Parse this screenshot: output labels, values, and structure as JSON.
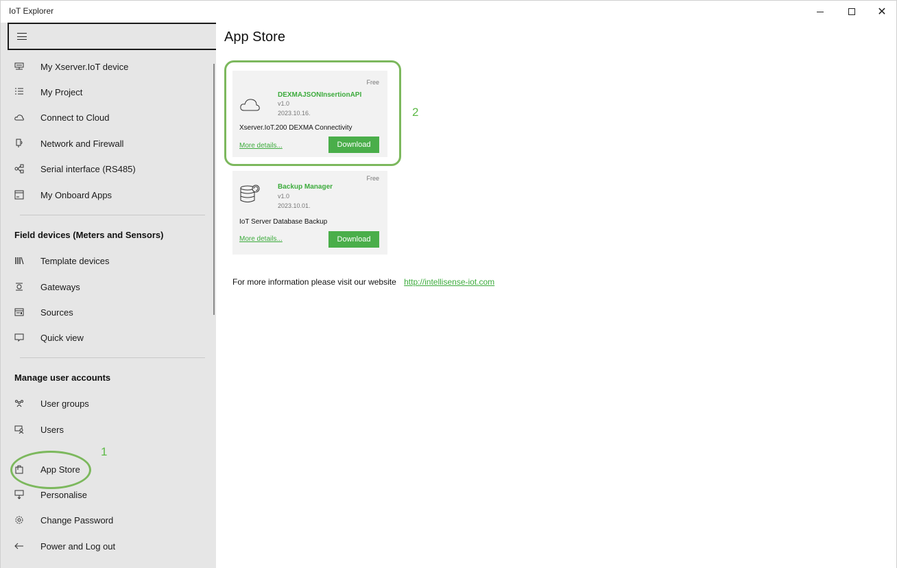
{
  "window": {
    "title": "IoT Explorer"
  },
  "sidebar": {
    "top_items": [
      {
        "label": "My Xserver.IoT device",
        "icon": "server-icon"
      },
      {
        "label": "My Project",
        "icon": "list-icon"
      },
      {
        "label": "Connect to Cloud",
        "icon": "cloud-icon"
      },
      {
        "label": "Network and Firewall",
        "icon": "network-icon"
      },
      {
        "label": "Serial interface (RS485)",
        "icon": "share-icon"
      },
      {
        "label": "My Onboard Apps",
        "icon": "apps-icon"
      }
    ],
    "field_section": "Field devices (Meters and Sensors)",
    "field_items": [
      {
        "label": "Template devices",
        "icon": "library-icon"
      },
      {
        "label": "Gateways",
        "icon": "gateway-icon"
      },
      {
        "label": "Sources",
        "icon": "sources-icon"
      },
      {
        "label": "Quick view",
        "icon": "quick-view-icon"
      }
    ],
    "accounts_section": "Manage user accounts",
    "account_items": [
      {
        "label": "User groups",
        "icon": "user-groups-icon"
      },
      {
        "label": "Users",
        "icon": "users-icon"
      },
      {
        "label": "App Store",
        "icon": "store-icon"
      },
      {
        "label": "Personalise",
        "icon": "personalise-icon"
      },
      {
        "label": "Change Password",
        "icon": "gear-icon"
      },
      {
        "label": "Power and Log out",
        "icon": "back-arrow-icon"
      }
    ]
  },
  "annotations": {
    "first": "1",
    "second": "2"
  },
  "main": {
    "title": "App Store",
    "apps": [
      {
        "price": "Free",
        "name": "DEXMAJSONInsertionAPI",
        "version": "v1.0",
        "date": "2023.10.16.",
        "description": "Xserver.IoT.200 DEXMA Connectivity",
        "more": "More details...",
        "download": "Download",
        "icon": "cloud-icon"
      },
      {
        "price": "Free",
        "name": "Backup Manager",
        "version": "v1.0",
        "date": "2023.10.01.",
        "description": "IoT Server Database Backup",
        "more": "More details...",
        "download": "Download",
        "icon": "database-backup-icon"
      }
    ],
    "info_text": "For more information please visit our website",
    "info_link": "http://intellisense-iot.com"
  }
}
